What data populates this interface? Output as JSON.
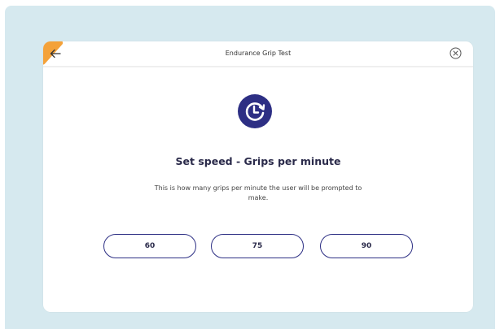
{
  "screen": {
    "title": "Endurance Grip Test"
  },
  "icons": {
    "back": "arrow-left-icon",
    "close": "circle-x-icon",
    "timer": "clock-refresh-icon"
  },
  "main": {
    "heading": "Set speed - Grips per minute",
    "description": "This is how many grips per minute the user will be prompted to make."
  },
  "options": [
    {
      "label": "60"
    },
    {
      "label": "75"
    },
    {
      "label": "90"
    }
  ],
  "colors": {
    "accent_navy": "#2d2f84",
    "frame_background": "#d6e9ef",
    "corner_accent": "#f4a23a"
  }
}
